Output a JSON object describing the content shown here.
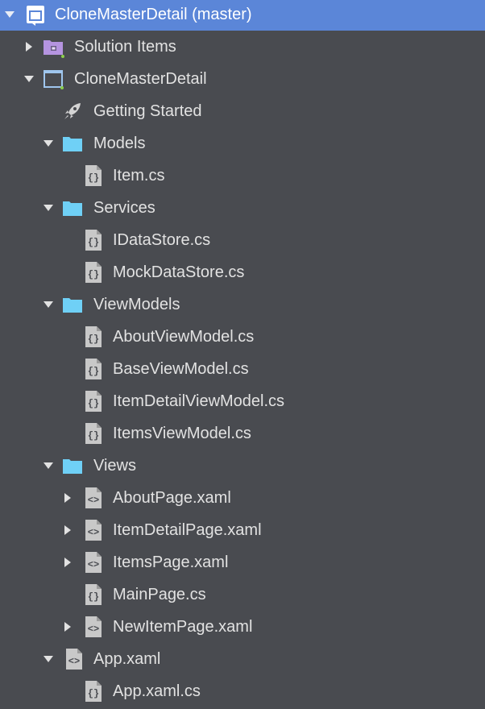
{
  "tree": {
    "root": {
      "label": "CloneMasterDetail (master)",
      "icon": "solution-icon",
      "expanded": true,
      "selected": true
    },
    "solution_items": {
      "label": "Solution Items",
      "icon": "solution-folder-icon",
      "expanded": false
    },
    "project": {
      "label": "CloneMasterDetail",
      "icon": "project-icon",
      "expanded": true
    },
    "getting_started": {
      "label": "Getting Started",
      "icon": "rocket-icon"
    },
    "models": {
      "label": "Models",
      "icon": "folder-icon",
      "expanded": true
    },
    "item_cs": {
      "label": "Item.cs",
      "icon": "csharp-file-icon"
    },
    "services": {
      "label": "Services",
      "icon": "folder-icon",
      "expanded": true
    },
    "idatastore_cs": {
      "label": "IDataStore.cs",
      "icon": "csharp-file-icon"
    },
    "mockdatastore_cs": {
      "label": "MockDataStore.cs",
      "icon": "csharp-file-icon"
    },
    "viewmodels": {
      "label": "ViewModels",
      "icon": "folder-icon",
      "expanded": true
    },
    "aboutviewmodel_cs": {
      "label": "AboutViewModel.cs",
      "icon": "csharp-file-icon"
    },
    "baseviewmodel_cs": {
      "label": "BaseViewModel.cs",
      "icon": "csharp-file-icon"
    },
    "itemdetailviewmodel_cs": {
      "label": "ItemDetailViewModel.cs",
      "icon": "csharp-file-icon"
    },
    "itemsviewmodel_cs": {
      "label": "ItemsViewModel.cs",
      "icon": "csharp-file-icon"
    },
    "views": {
      "label": "Views",
      "icon": "folder-icon",
      "expanded": true
    },
    "aboutpage_xaml": {
      "label": "AboutPage.xaml",
      "icon": "xaml-file-icon",
      "expanded": false
    },
    "itemdetailpage_xaml": {
      "label": "ItemDetailPage.xaml",
      "icon": "xaml-file-icon",
      "expanded": false
    },
    "itemspage_xaml": {
      "label": "ItemsPage.xaml",
      "icon": "xaml-file-icon",
      "expanded": false
    },
    "mainpage_cs": {
      "label": "MainPage.cs",
      "icon": "csharp-file-icon"
    },
    "newitempage_xaml": {
      "label": "NewItemPage.xaml",
      "icon": "xaml-file-icon",
      "expanded": false
    },
    "app_xaml": {
      "label": "App.xaml",
      "icon": "xaml-file-icon",
      "expanded": true
    },
    "app_xaml_cs": {
      "label": "App.xaml.cs",
      "icon": "csharp-file-icon"
    }
  },
  "colors": {
    "background": "#494b50",
    "selection": "#5b86d8",
    "folder": "#6fd0f6",
    "solution_folder": "#b594e0",
    "text": "#e2e2e2"
  }
}
